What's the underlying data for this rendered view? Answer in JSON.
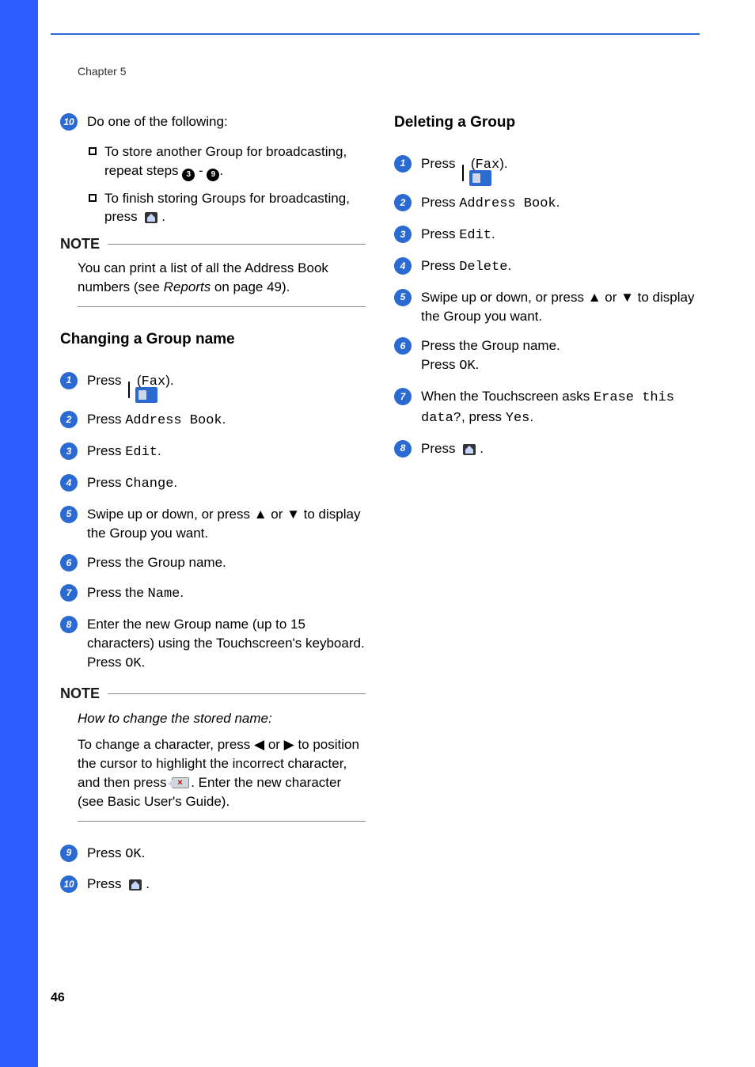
{
  "chapter": "Chapter 5",
  "pageNumber": "46",
  "left": {
    "step10": {
      "lead": "Do one of the following:",
      "b1a": "To store another Group for broadcasting, repeat steps ",
      "b1ref1": "3",
      "b1mid": " - ",
      "b1ref2": "9",
      "b1end": ".",
      "b2a": "To finish storing Groups for broadcasting, press ",
      "b2end": "."
    },
    "note1": {
      "heading": "NOTE",
      "line1a": "You can print a list of all the Address Book numbers (see ",
      "reportsLink": "Reports",
      "line1b": " on page 49)."
    },
    "h1": "Changing a Group name",
    "s1a": "Press ",
    "s1b": " (",
    "s1fax": "Fax",
    "s1c": ").",
    "s2a": "Press ",
    "s2b": "Address Book",
    "s2c": ".",
    "s3a": "Press ",
    "s3b": "Edit",
    "s3c": ".",
    "s4a": "Press ",
    "s4b": "Change",
    "s4c": ".",
    "s5": "Swipe up or down, or press ▲ or ▼ to display the Group you want.",
    "s6": "Press the Group name.",
    "s7a": "Press the ",
    "s7b": "Name",
    "s7c": ".",
    "s8a": "Enter the new Group name (up to 15 characters) using the Touchscreen's keyboard.",
    "s8b": "Press ",
    "s8ok": "OK",
    "s8c": ".",
    "note2": {
      "heading": "NOTE",
      "intro": "How to change the stored name:",
      "body1": "To change a character, press ◀ or ▶ to position the cursor to highlight the incorrect character, and then press ",
      "body2": ". Enter the new character (see Basic User's Guide)."
    },
    "s9a": "Press ",
    "s9ok": "OK",
    "s9b": ".",
    "s10a": "Press ",
    "s10b": "."
  },
  "right": {
    "h1": "Deleting a Group",
    "s1a": "Press ",
    "s1b": " (",
    "s1fax": "Fax",
    "s1c": ").",
    "s2a": "Press ",
    "s2b": "Address Book",
    "s2c": ".",
    "s3a": "Press ",
    "s3b": "Edit",
    "s3c": ".",
    "s4a": "Press ",
    "s4b": "Delete",
    "s4c": ".",
    "s5": "Swipe up or down, or press ▲ or ▼ to display the Group you want.",
    "s6a": "Press the Group name.",
    "s6b": "Press ",
    "s6ok": "OK",
    "s6c": ".",
    "s7a": "When the Touchscreen asks ",
    "s7erase": "Erase this data?",
    "s7b": ", press ",
    "s7yes": "Yes",
    "s7c": ".",
    "s8a": "Press ",
    "s8b": "."
  }
}
